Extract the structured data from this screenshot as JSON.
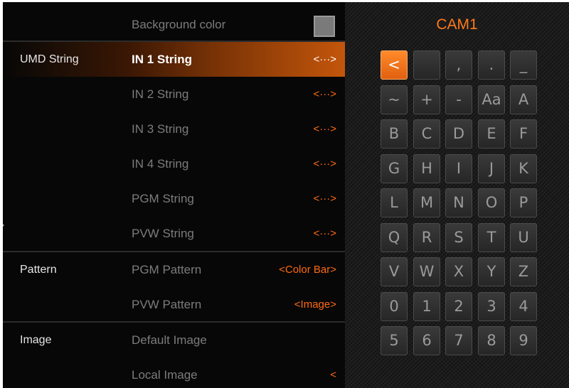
{
  "menu": {
    "rows": [
      {
        "category": "",
        "label": "Background color",
        "value": ""
      },
      {
        "category": "UMD String",
        "label": "IN 1 String",
        "value": "<···>"
      },
      {
        "category": "",
        "label": "IN 2 String",
        "value": "<···>"
      },
      {
        "category": "",
        "label": "IN 3 String",
        "value": "<···>"
      },
      {
        "category": "",
        "label": "IN 4 String",
        "value": "<···>"
      },
      {
        "category": "",
        "label": "PGM String",
        "value": "<···>"
      },
      {
        "category": "",
        "label": "PVW String",
        "value": "<···>"
      },
      {
        "category": "Pattern",
        "label": "PGM Pattern",
        "value": "<Color Bar>"
      },
      {
        "category": "",
        "label": "PVW Pattern",
        "value": "<Image>"
      },
      {
        "category": "Image",
        "label": "Default Image",
        "value": ""
      },
      {
        "category": "",
        "label": "Local Image",
        "value": "<"
      }
    ],
    "background_swatch_color": "#7a7a7a",
    "accent_color": "#ff6a10"
  },
  "panel": {
    "title": "CAM1",
    "keys": [
      [
        "<",
        "",
        ",",
        ".",
        "_"
      ],
      [
        "~",
        "+",
        "-",
        "Aa",
        "A"
      ],
      [
        "B",
        "C",
        "D",
        "E",
        "F"
      ],
      [
        "G",
        "H",
        "I",
        "J",
        "K"
      ],
      [
        "L",
        "M",
        "N",
        "O",
        "P"
      ],
      [
        "Q",
        "R",
        "S",
        "T",
        "U"
      ],
      [
        "V",
        "W",
        "X",
        "Y",
        "Z"
      ],
      [
        "0",
        "1",
        "2",
        "3",
        "4"
      ],
      [
        "5",
        "6",
        "7",
        "8",
        "9"
      ]
    ],
    "selected_key": "<"
  }
}
